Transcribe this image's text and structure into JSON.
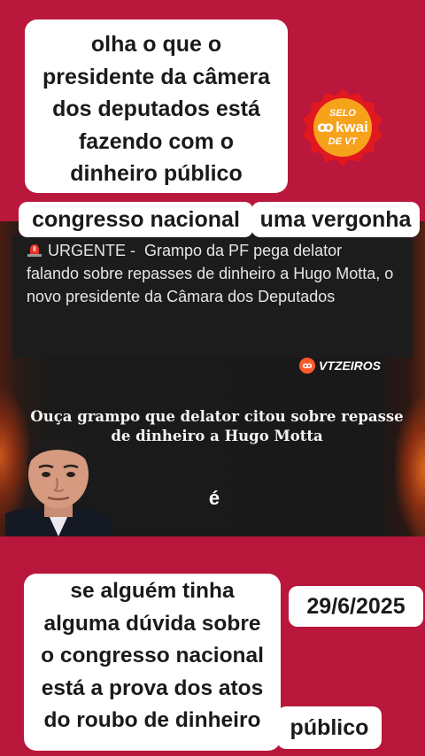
{
  "overlay_top": {
    "lines": [
      "olha o que o",
      "presidente da câmera",
      "dos deputados está",
      "fazendo com o",
      "dinheiro público"
    ]
  },
  "tag_congress": "congresso nacional",
  "tag_vergonha": "uma vergonha",
  "seal": {
    "line1": "SELO",
    "brand": "kwai",
    "line3": "DE VT",
    "colors": {
      "fill": "#f7a21b",
      "ring": "#e2181f"
    }
  },
  "video": {
    "news_prefix": "URGENTE -",
    "news_text": "Grampo da PF pega delator falando sobre repasses de dinheiro a Hugo Motta, o novo presidente da Câmara dos Deputados",
    "watermark": "VTZEIROS",
    "caption_line1": "Ouça grampo que delator citou sobre repasse",
    "caption_line2": "de dinheiro a Hugo Motta",
    "subtitle": "é"
  },
  "overlay_bottom": {
    "lines": [
      "se alguém tinha",
      "alguma dúvida sobre",
      "o congresso nacional",
      "está a prova dos atos",
      "do roubo de dinheiro"
    ]
  },
  "date": "29/6/2025",
  "tag_publico": "público",
  "colors": {
    "background": "#b8143a",
    "box": "#ffffff",
    "text": "#1a1a1a"
  }
}
